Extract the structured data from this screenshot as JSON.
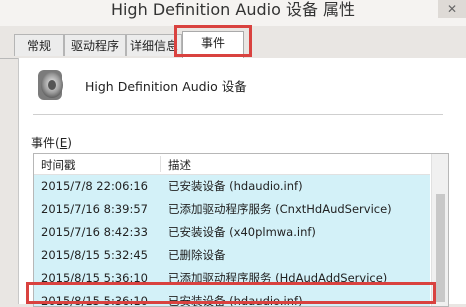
{
  "window": {
    "title": "High Definition Audio 设备 属性",
    "close_label": "✕"
  },
  "tabs": [
    {
      "label": "常规",
      "active": false
    },
    {
      "label": "驱动程序",
      "active": false
    },
    {
      "label": "详细信息",
      "active": false
    },
    {
      "label": "事件",
      "active": true
    }
  ],
  "device": {
    "name": "High Definition Audio 设备",
    "icon": "speaker-icon"
  },
  "events": {
    "label_prefix": "事件(",
    "label_key": "E",
    "label_suffix": ")",
    "columns": {
      "time": "时间戳",
      "description": "描述"
    },
    "rows": [
      {
        "time": "2015/7/8 22:06:16",
        "description": "已安装设备 (hdaudio.inf)"
      },
      {
        "time": "2015/7/16 8:39:57",
        "description": "已添加驱动程序服务 (CnxtHdAudService)"
      },
      {
        "time": "2015/7/16 8:42:33",
        "description": "已安装设备 (x40plmwa.inf)"
      },
      {
        "time": "2015/8/15 5:32:45",
        "description": "已删除设备"
      },
      {
        "time": "2015/8/15 5:36:10",
        "description": "已添加驱动程序服务 (HdAudAddService)"
      },
      {
        "time": "2015/8/15 5:36:10",
        "description": "已安装设备 (hdaudio.inf)"
      }
    ]
  },
  "colors": {
    "row_background": "#d3f1f8",
    "highlight_border": "#d9423f"
  }
}
